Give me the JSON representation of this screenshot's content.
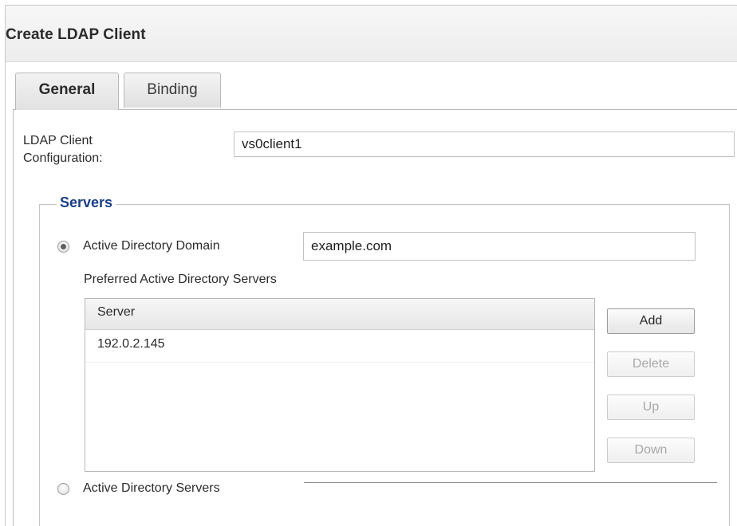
{
  "window": {
    "title": "Create LDAP Client"
  },
  "tabs": [
    {
      "label": "General",
      "active": true
    },
    {
      "label": "Binding",
      "active": false
    }
  ],
  "general": {
    "client_config_label": "LDAP Client Configuration:",
    "client_config_value": "vs0client1",
    "servers_group": {
      "legend": "Servers",
      "ad_domain_option": {
        "label": "Active Directory Domain",
        "selected": true,
        "value": "example.com"
      },
      "preferred_label": "Preferred Active Directory Servers",
      "table": {
        "columns": [
          "Server"
        ],
        "rows": [
          [
            "192.0.2.145"
          ]
        ]
      },
      "buttons": {
        "add": "Add",
        "delete": "Delete",
        "up": "Up",
        "down": "Down"
      },
      "ad_servers_option": {
        "label": "Active Directory Servers",
        "selected": false
      }
    }
  },
  "colors": {
    "legend": "#1b3f86",
    "text": "#2b2b2b",
    "disabled_text": "#a9a9a9"
  }
}
